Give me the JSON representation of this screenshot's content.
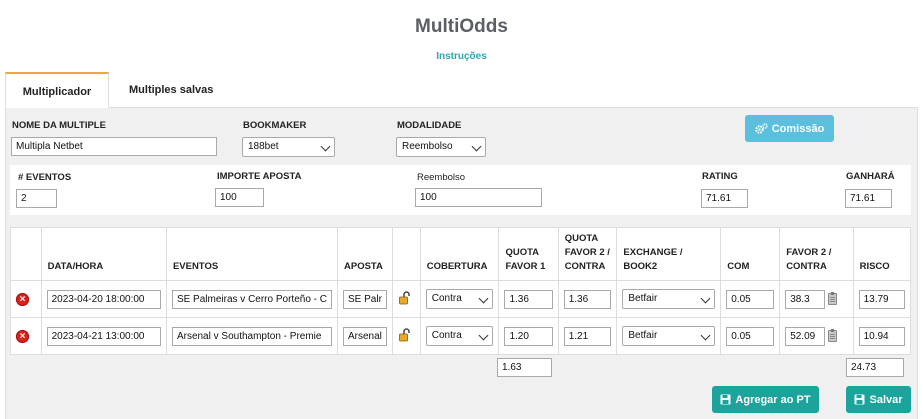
{
  "app": {
    "title": "MultiOdds",
    "instructions": "Instruções"
  },
  "tabs": [
    {
      "label": "Multiplicador"
    },
    {
      "label": "Multiples salvas"
    }
  ],
  "form": {
    "name_label": "NOME DA MULTIPLE",
    "name_value": "Multipla Netbet",
    "bookmaker_label": "BOOKMAKER",
    "bookmaker_value": "188bet",
    "modalidade_label": "MODALIDADE",
    "modalidade_value": "Reembolso",
    "comissao_button": "Comissão"
  },
  "summary": {
    "eventos_label": "# EVENTOS",
    "eventos_value": "2",
    "importe_label": "IMPORTE APOSTA",
    "importe_value": "100",
    "reembolso_label": "Reembolso",
    "reembolso_value": "100",
    "rating_label": "RATING",
    "rating_value": "71.61",
    "ganhara_label": "GANHARÁ",
    "ganhara_value": "71.61"
  },
  "table": {
    "headers": {
      "datahora": "DATA/HORA",
      "eventos": "EVENTOS",
      "aposta": "APOSTA",
      "cobertura": "COBERTURA",
      "quota1": "QUOTA FAVOR 1",
      "quota2": "QUOTA FAVOR 2 / CONTRA",
      "exchange": "EXCHANGE / BOOK2",
      "com": "COM",
      "favor2": "FAVOR 2 / CONTRA",
      "risco": "RISCO"
    },
    "rows": [
      {
        "datetime": "2023-04-20 18:00:00",
        "event": "SE Palmeiras v Cerro Porteño - C",
        "bet": "SE Palr",
        "cobertura": "Contra",
        "quota1": "1.36",
        "quota2": "1.36",
        "exchange": "Betfair",
        "com": "0.05",
        "favor2": "38.3",
        "risco": "13.79"
      },
      {
        "datetime": "2023-04-21 13:00:00",
        "event": "Arsenal v Southampton - Premie",
        "bet": "Arsenal",
        "cobertura": "Contra",
        "quota1": "1.20",
        "quota2": "1.21",
        "exchange": "Betfair",
        "com": "0.05",
        "favor2": "52.09",
        "risco": "10.94"
      }
    ],
    "total_quota": "1.63",
    "total_risco": "24.73"
  },
  "actions": {
    "agregar": "Agregar ao PT",
    "salvar": "Salvar"
  },
  "colors": {
    "accent": "#1ba39c",
    "info": "#5bc0de",
    "tab_top": "#e7a94a",
    "delete": "#d9221b"
  },
  "icons": {
    "delete": "delete-icon",
    "lock": "unlock-icon",
    "clipboard": "clipboard-icon",
    "cogs": "cogs-icon",
    "save": "save-icon"
  }
}
